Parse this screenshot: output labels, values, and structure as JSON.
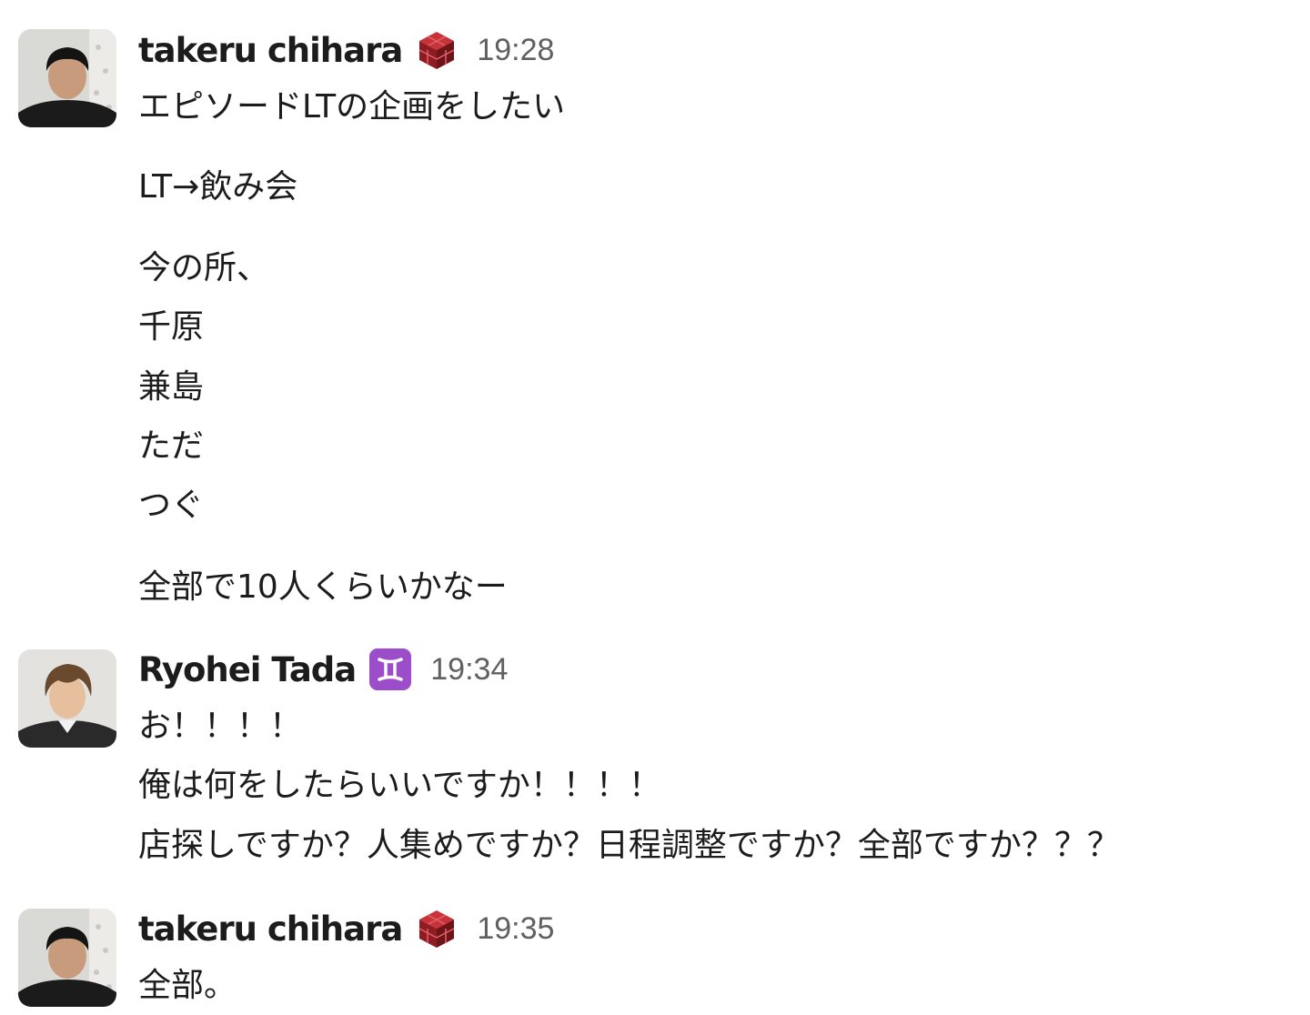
{
  "messages": [
    {
      "author": "takeru chihara",
      "status_icon": "red-cube-icon",
      "time": "19:28",
      "lines": [
        "エピソードLTの企画をしたい",
        "LT→飲み会",
        "今の所、",
        "千原",
        "兼島",
        "ただ",
        "つぐ",
        "全部で10人くらいかなー"
      ]
    },
    {
      "author": "Ryohei Tada",
      "status_icon": "gemini-icon",
      "time": "19:34",
      "lines": [
        "お！！！！",
        "俺は何をしたらいいですか！！！！",
        "店探しですか？人集めですか？日程調整ですか？全部ですか？？？"
      ]
    },
    {
      "author": "takeru chihara",
      "status_icon": "red-cube-icon",
      "time": "19:35",
      "lines": [
        "全部。"
      ]
    }
  ],
  "colors": {
    "text": "#1d1c1d",
    "timestamp": "#616061",
    "cube": "#b3242b",
    "gemini": "#9b4dca"
  }
}
